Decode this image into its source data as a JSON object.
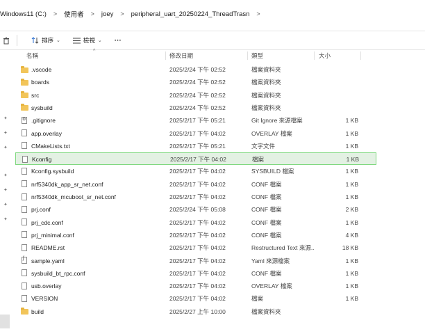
{
  "breadcrumb": [
    "Windows11 (C:)",
    "使用者",
    "joey",
    "peripheral_uart_20250224_ThreadTrasn"
  ],
  "breadcrumb_sep": ">",
  "toolbar": {
    "sort_label": "排序",
    "view_label": "檢視",
    "more_label": "···"
  },
  "columns": {
    "name": "名稱",
    "date": "修改日期",
    "type": "類型",
    "size": "大小"
  },
  "files": [
    {
      "name": ".vscode",
      "date": "2025/2/24 下午 02:52",
      "type": "檔案資料夾",
      "size": "",
      "icon": "folder-icon"
    },
    {
      "name": "boards",
      "date": "2025/2/24 下午 02:52",
      "type": "檔案資料夾",
      "size": "",
      "icon": "folder-icon"
    },
    {
      "name": "src",
      "date": "2025/2/24 下午 02:52",
      "type": "檔案資料夾",
      "size": "",
      "icon": "folder-icon"
    },
    {
      "name": "sysbuild",
      "date": "2025/2/24 下午 02:52",
      "type": "檔案資料夾",
      "size": "",
      "icon": "folder-icon"
    },
    {
      "name": ".gitignore",
      "date": "2025/2/17 下午 05:21",
      "type": "Git Ignore 來源檔案",
      "size": "1 KB",
      "icon": "gear-file-icon"
    },
    {
      "name": "app.overlay",
      "date": "2025/2/17 下午 04:02",
      "type": "OVERLAY 檔案",
      "size": "1 KB",
      "icon": "file-icon"
    },
    {
      "name": "CMakeLists.txt",
      "date": "2025/2/17 下午 05:21",
      "type": "文字文件",
      "size": "1 KB",
      "icon": "file-icon"
    },
    {
      "name": "Kconfig",
      "date": "2025/2/17 下午 04:02",
      "type": "檔案",
      "size": "1 KB",
      "icon": "file-icon",
      "selected": true
    },
    {
      "name": "Kconfig.sysbuild",
      "date": "2025/2/17 下午 04:02",
      "type": "SYSBUILD 檔案",
      "size": "1 KB",
      "icon": "file-icon"
    },
    {
      "name": "nrf5340dk_app_sr_net.conf",
      "date": "2025/2/17 下午 04:02",
      "type": "CONF 檔案",
      "size": "1 KB",
      "icon": "file-icon"
    },
    {
      "name": "nrf5340dk_mcuboot_sr_net.conf",
      "date": "2025/2/17 下午 04:02",
      "type": "CONF 檔案",
      "size": "1 KB",
      "icon": "file-icon"
    },
    {
      "name": "prj.conf",
      "date": "2025/2/24 下午 05:08",
      "type": "CONF 檔案",
      "size": "2 KB",
      "icon": "file-icon"
    },
    {
      "name": "prj_cdc.conf",
      "date": "2025/2/17 下午 04:02",
      "type": "CONF 檔案",
      "size": "1 KB",
      "icon": "file-icon"
    },
    {
      "name": "prj_minimal.conf",
      "date": "2025/2/17 下午 04:02",
      "type": "CONF 檔案",
      "size": "4 KB",
      "icon": "file-icon"
    },
    {
      "name": "README.rst",
      "date": "2025/2/17 下午 04:02",
      "type": "Restructured Text 來源...",
      "size": "18 KB",
      "icon": "file-icon"
    },
    {
      "name": "sample.yaml",
      "date": "2025/2/17 下午 04:02",
      "type": "Yaml 來源檔案",
      "size": "1 KB",
      "icon": "script-file-icon"
    },
    {
      "name": "sysbuild_bt_rpc.conf",
      "date": "2025/2/17 下午 04:02",
      "type": "CONF 檔案",
      "size": "1 KB",
      "icon": "file-icon"
    },
    {
      "name": "usb.overlay",
      "date": "2025/2/17 下午 04:02",
      "type": "OVERLAY 檔案",
      "size": "1 KB",
      "icon": "file-icon"
    },
    {
      "name": "VERSION",
      "date": "2025/2/17 下午 04:02",
      "type": "檔案",
      "size": "1 KB",
      "icon": "file-icon"
    },
    {
      "name": "build",
      "date": "2025/2/27 上午 10:00",
      "type": "檔案資料夾",
      "size": "",
      "icon": "folder-icon"
    }
  ]
}
